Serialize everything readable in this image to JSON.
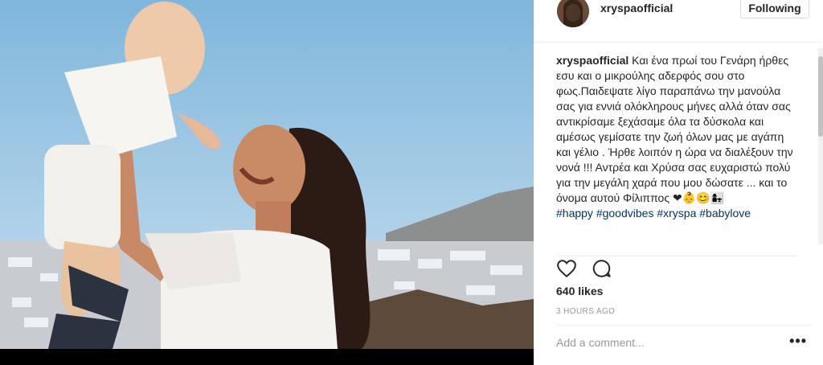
{
  "post": {
    "username": "xryspaofficial",
    "follow_label": "Following",
    "caption_username": "xryspaofficial",
    "caption_text": "Και ένα πρωί του Γενάρη ήρθες εσυ και ο μικρούλης αδερφός σου στο φως.Παιδεψατε λίγο παραπάνω την μανούλα σας για εννιά ολόκληρους μήνες αλλά όταν σας αντικρίσαμε ξεχάσαμε όλα τα δύσκολα και αμέσως γεμίσατε την ζωή όλων μας με αγάπη και γέλιο . Ήρθε λοιπόν η ώρα να διαλέξουν την νονά !!! Αντρέα και Χρύσα σας ευχαριστώ πολύ για την μεγάλη χαρά που μου δώσατε ... και το όνομα αυτού Φίλιππος ❤👶😊👩‍👧",
    "hashtags": [
      "#happy",
      "#goodvibes",
      "#xryspa",
      "#babylove"
    ],
    "likes": "640 likes",
    "timestamp": "3 HOURS AGO",
    "comment_placeholder": "Add a comment...",
    "more_label": "•••"
  },
  "icons": {
    "like": "heart-icon",
    "comment": "comment-icon"
  }
}
